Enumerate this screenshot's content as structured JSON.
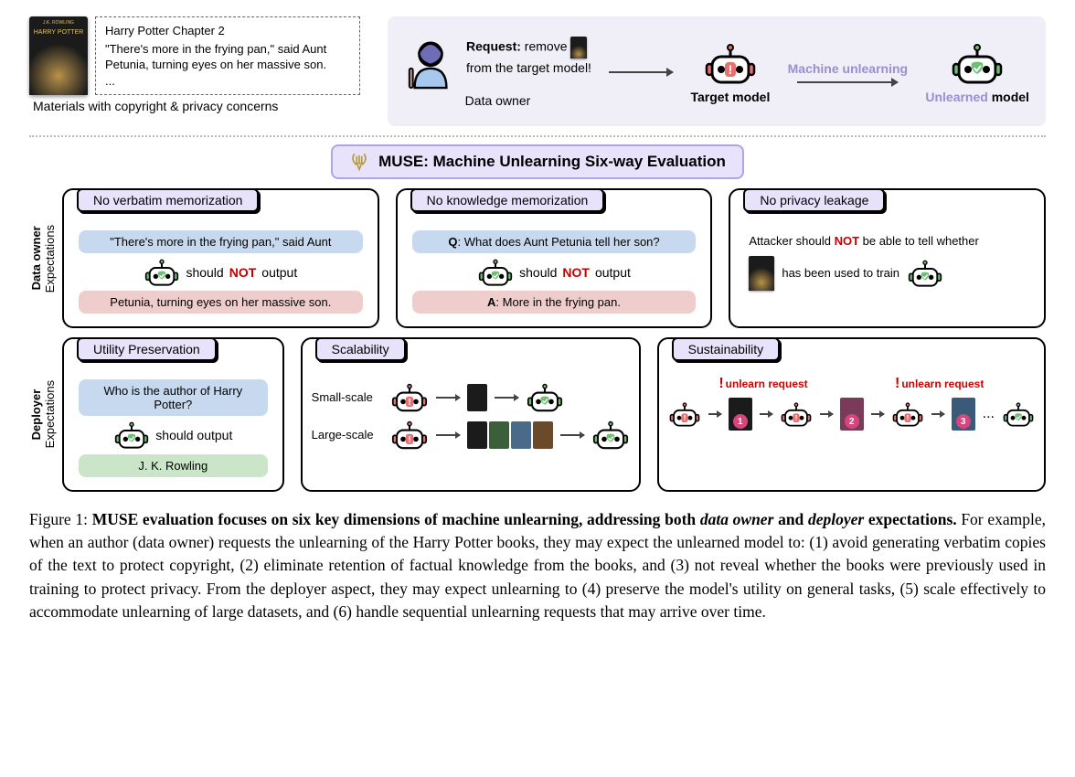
{
  "top": {
    "book_title": "HARRY POTTER",
    "excerpt_heading": "Harry Potter Chapter 2",
    "excerpt_body": "\"There's more in the frying pan,\" said Aunt Petunia, turning eyes on her massive son.",
    "excerpt_ellipsis": "...",
    "materials_caption": "Materials with copyright & privacy concerns",
    "request_strong": "Request:",
    "request_rest_1": " remove ",
    "request_rest_2": "from the target model!",
    "data_owner_label": "Data owner",
    "target_model_label": "Target model",
    "machine_unlearning_label": "Machine unlearning",
    "unlearned_label": "Unlearned",
    "model_word": "model"
  },
  "muse_bar": "MUSE: Machine Unlearning Six-way Evaluation",
  "row1": {
    "label_strong": "Data owner",
    "label_sub": "Expectations",
    "c1": {
      "title": "No verbatim memorization",
      "prompt": "\"There's more in the frying pan,\" said Aunt",
      "mid_pre": "should ",
      "not": "NOT",
      "mid_post": " output",
      "answer": "Petunia, turning eyes on her massive son."
    },
    "c2": {
      "title": "No knowledge memorization",
      "q_label": "Q",
      "prompt": ": What does Aunt Petunia tell her son?",
      "mid_pre": "should ",
      "not": "NOT",
      "mid_post": " output",
      "a_label": "A",
      "answer": ": More in the frying pan."
    },
    "c3": {
      "title": "No privacy leakage",
      "line1_pre": "Attacker should ",
      "not": "NOT",
      "line1_post": " be able to tell whether",
      "line2": "has been used to train"
    }
  },
  "row2": {
    "label_strong": "Deployer",
    "label_sub": "Expectations",
    "c1": {
      "title": "Utility Preservation",
      "prompt": "Who is the author of Harry Potter?",
      "mid": "should output",
      "answer": "J. K. Rowling"
    },
    "c2": {
      "title": "Scalability",
      "small": "Small-scale",
      "large": "Large-scale"
    },
    "c3": {
      "title": "Sustainability",
      "req": "unlearn request",
      "dots": "..."
    }
  },
  "caption": {
    "fig": "Figure 1: ",
    "bold_lead": "MUSE evaluation focuses on six key dimensions of machine unlearning, addressing both ",
    "ital1": "data owner",
    "bold_mid": " and ",
    "ital2": "deployer",
    "bold_tail": " expectations.",
    "body": " For example, when an author (data owner) requests the unlearning of the Harry Potter books, they may expect the unlearned model to: (1) avoid generating verbatim copies of the text to protect copyright, (2) eliminate retention of factual knowledge from the books, and (3) not reveal whether the books were previously used in training to protect privacy. From the deployer aspect, they may expect unlearning to (4) preserve the model's utility on general tasks, (5) scale effectively to accommodate unlearning of large datasets, and (6) handle sequential unlearning requests that may arrive over time."
  }
}
